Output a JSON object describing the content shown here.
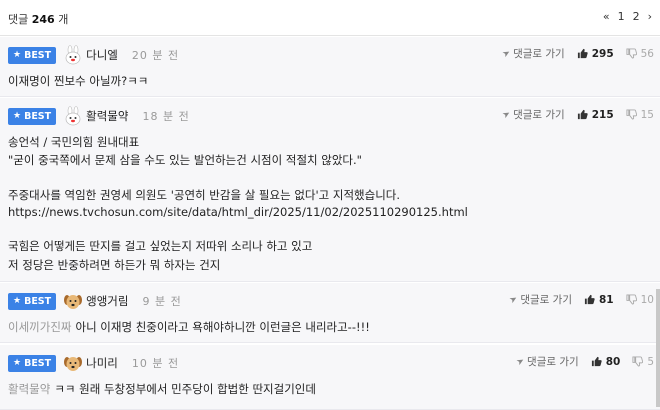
{
  "header": {
    "count_label": "댓글",
    "count_value": "246",
    "count_unit": "개",
    "pager": {
      "prev_icon": "«",
      "pages": [
        "1",
        "2"
      ],
      "next_icon": "›"
    }
  },
  "reply_label": "댓글로 가기",
  "best_label": "BEST",
  "comments": [
    {
      "nickname": "다니엘",
      "time": "20 분 전",
      "up": "295",
      "down": "56",
      "avatar": "bunny-icon",
      "lines": [
        "이재명이 찐보수 아닐까?ㅋㅋ"
      ]
    },
    {
      "nickname": "활력물약",
      "time": "18 분 전",
      "up": "215",
      "down": "15",
      "avatar": "bunny-icon",
      "lines": [
        "송언석 / 국민의힘 원내대표",
        "\"굳이 중국쪽에서 문제 삼을 수도 있는 발언하는건 시점이 적절치 않았다.\"",
        "주중대사를 역임한 권영세 의원도 '공연히 반감을 살 필요는 없다'고 지적했습니다.",
        "https://news.tvchosun.com/site/data/html_dir/2025/11/02/2025110290125.html",
        "국힘은 어떻게든 딴지를 걸고 싶었는지 저따위 소리나 하고 있고",
        "저 정당은 반중하려면 하든가 뭐 하자는 건지"
      ]
    },
    {
      "nickname": "앵앵거림",
      "time": "9 분 전",
      "up": "81",
      "down": "10",
      "avatar": "dog-icon",
      "mention": "이세끼가진짜",
      "lines": [
        "아니 이재명 친중이라고 욕해야하니깐 이런글은 내리라고--!!!"
      ]
    },
    {
      "nickname": "나미리",
      "time": "10 분 전",
      "up": "80",
      "down": "5",
      "avatar": "dog-icon",
      "mention": "활력물약",
      "lines": [
        "ㅋㅋ 원래 두창정부에서 민주당이 합법한 딴지걸기인데"
      ]
    }
  ]
}
